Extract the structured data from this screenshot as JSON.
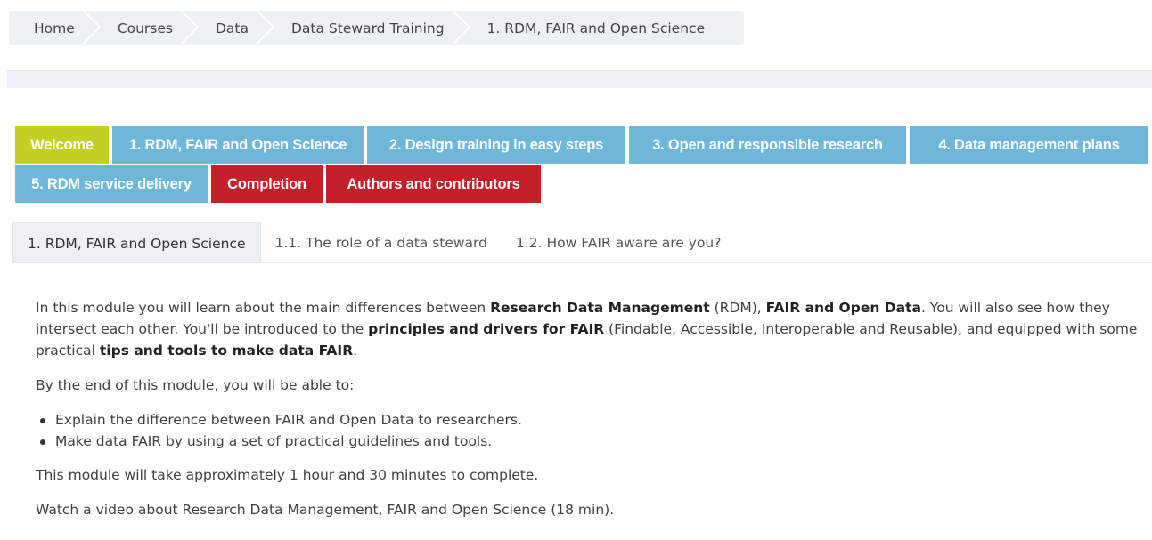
{
  "breadcrumb": {
    "items": [
      "Home",
      "Courses",
      "Data",
      "Data Steward Training",
      "1. RDM, FAIR and Open Science"
    ]
  },
  "modules": {
    "row1": [
      {
        "label": "Welcome",
        "color": "#c3cf23"
      },
      {
        "label": "1. RDM, FAIR and Open Science",
        "color": "#6fb7d8"
      },
      {
        "label": "2. Design training in easy steps",
        "color": "#6fb7d8"
      },
      {
        "label": "3. Open and responsible research",
        "color": "#6fb7d8"
      },
      {
        "label": "4. Data management plans",
        "color": "#6fb7d8"
      }
    ],
    "row2": [
      {
        "label": "5. RDM service delivery",
        "color": "#6fb7d8"
      },
      {
        "label": "Completion",
        "color": "#c3202a"
      },
      {
        "label": "Authors and contributors",
        "color": "#c3202a"
      }
    ]
  },
  "tabs": [
    {
      "label": "1. RDM, FAIR and Open Science",
      "active": true
    },
    {
      "label": "1.1. The role of a data steward",
      "active": false
    },
    {
      "label": "1.2. How FAIR aware are you?",
      "active": false
    }
  ],
  "content": {
    "intro": {
      "t1": "In this module you will learn about the main differences between ",
      "b1": "Research Data Management",
      "t2": " (RDM), ",
      "b2": "FAIR and Open Data",
      "t3": ". You will also see how they intersect each other. You'll be introduced to the ",
      "b3": "principles and drivers for FAIR",
      "t4": " (Findable, Accessible, Interoperable and Reusable), and equipped with some practical ",
      "b4": "tips and tools to make data FAIR",
      "t5": "."
    },
    "outcomes_intro": "By the end of this module, you will be able to:",
    "outcomes": [
      "Explain the difference between FAIR and Open Data to researchers.",
      "Make data FAIR by using a set of practical guidelines and tools."
    ],
    "duration": "This module will take approximately 1 hour and 30 minutes to complete.",
    "video": "Watch a video about Research Data Management, FAIR and Open Science (18 min)."
  }
}
